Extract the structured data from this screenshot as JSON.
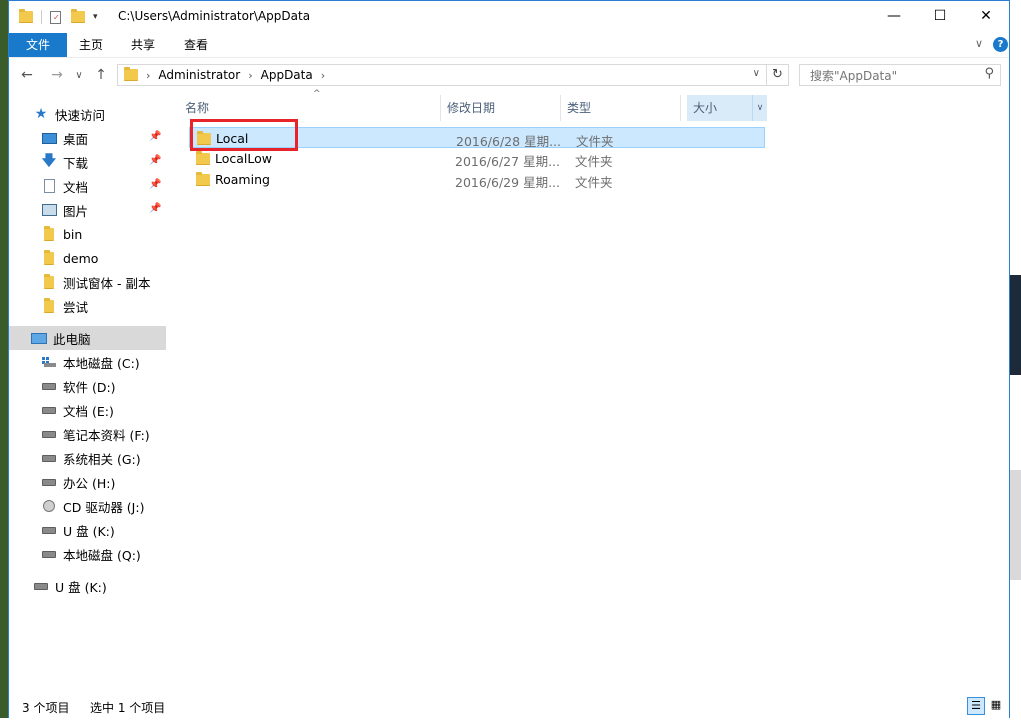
{
  "window": {
    "title_path": "C:\\Users\\Administrator\\AppData",
    "minimize": "—",
    "maximize": "☐",
    "close": "✕"
  },
  "ribbon": {
    "tabs": [
      "文件",
      "主页",
      "共享",
      "查看"
    ],
    "expand": "∨",
    "help": "?"
  },
  "nav": {
    "back": "←",
    "forward": "→",
    "recent": "∨",
    "up": "↑",
    "breadcrumb": [
      "Administrator",
      "AppData"
    ],
    "refresh": "↻",
    "search_placeholder": "搜索\"AppData\""
  },
  "sidebar": {
    "quick_access": "快速访问",
    "pinned": [
      {
        "label": "桌面",
        "icon": "desktop-icon"
      },
      {
        "label": "下载",
        "icon": "download-icon"
      },
      {
        "label": "文档",
        "icon": "document-icon"
      },
      {
        "label": "图片",
        "icon": "picture-icon"
      }
    ],
    "folders": [
      "bin",
      "demo",
      "测试窗体 - 副本",
      "尝试"
    ],
    "this_pc": "此电脑",
    "drives": [
      {
        "label": "本地磁盘 (C:)",
        "icon": "system-drive-icon"
      },
      {
        "label": "软件 (D:)",
        "icon": "drive-icon"
      },
      {
        "label": "文档 (E:)",
        "icon": "drive-icon"
      },
      {
        "label": "笔记本资料 (F:)",
        "icon": "drive-icon"
      },
      {
        "label": "系统相关 (G:)",
        "icon": "drive-icon"
      },
      {
        "label": "办公 (H:)",
        "icon": "drive-icon"
      },
      {
        "label": "CD 驱动器 (J:)",
        "icon": "cd-drive-icon"
      },
      {
        "label": "U 盘 (K:)",
        "icon": "drive-icon"
      },
      {
        "label": "本地磁盘 (Q:)",
        "icon": "drive-icon"
      }
    ],
    "usb": "U 盘 (K:)"
  },
  "columns": {
    "name": "名称",
    "date": "修改日期",
    "type": "类型",
    "size": "大小",
    "sort_arrow": "^",
    "dropdown": "∨"
  },
  "files": [
    {
      "name": "Local",
      "date": "2016/6/28 星期...",
      "type": "文件夹",
      "selected": true
    },
    {
      "name": "LocalLow",
      "date": "2016/6/27 星期...",
      "type": "文件夹",
      "selected": false
    },
    {
      "name": "Roaming",
      "date": "2016/6/29 星期...",
      "type": "文件夹",
      "selected": false
    }
  ],
  "status": {
    "count": "3 个项目",
    "selected": "选中 1 个项目"
  },
  "colors": {
    "accent": "#1979ca",
    "highlight_box": "#e8242b",
    "selection": "#cce8ff"
  }
}
